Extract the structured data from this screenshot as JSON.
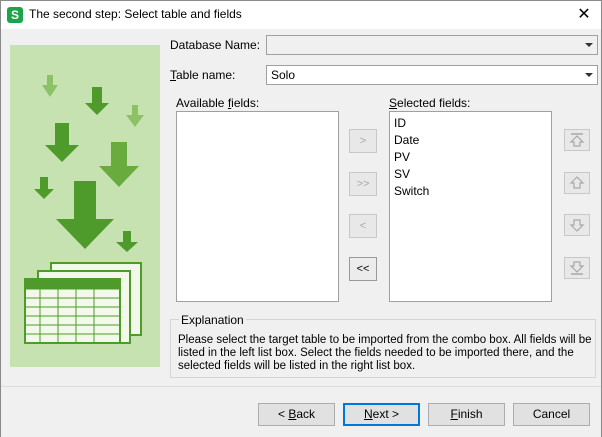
{
  "window": {
    "title": "The second step: Select table and fields",
    "app_icon_letter": "S",
    "close_glyph": "✕"
  },
  "form": {
    "database_label": "Database Name:",
    "database_value": "",
    "table_label_key": "T",
    "table_label_rest": "able name:",
    "table_value": "Solo"
  },
  "available": {
    "label_pre": "Available ",
    "label_key": "f",
    "label_post": "ields:",
    "items": []
  },
  "selected": {
    "label_pre": "",
    "label_key": "S",
    "label_post": "elected fields:",
    "items": [
      "ID",
      "Date",
      "PV",
      "SV",
      "Switch"
    ]
  },
  "transfer_buttons": {
    "add_one": ">",
    "add_all": ">>",
    "remove_one": "<",
    "remove_all": "<<"
  },
  "order_buttons": {
    "icons": [
      "move-top-icon",
      "move-up-icon",
      "move-down-icon",
      "move-bottom-icon"
    ]
  },
  "explanation": {
    "title": "Explanation",
    "text": "Please select the target table to be imported from the combo box. All fields will be listed in the left list box. Select the fields needed to be imported there, and the selected fields will be listed in the right list box."
  },
  "footer": {
    "back_glyph": "< ",
    "back_key": "B",
    "back_rest": "ack",
    "next_key": "N",
    "next_rest": "ext >",
    "finish_key": "F",
    "finish_rest": "inish",
    "cancel": "Cancel"
  },
  "colors": {
    "illustration_bg": "#c6e2b0",
    "arrow_dark": "#4e9a2a",
    "arrow_light": "#8cc265",
    "accent_default_button": "#0078d7"
  }
}
